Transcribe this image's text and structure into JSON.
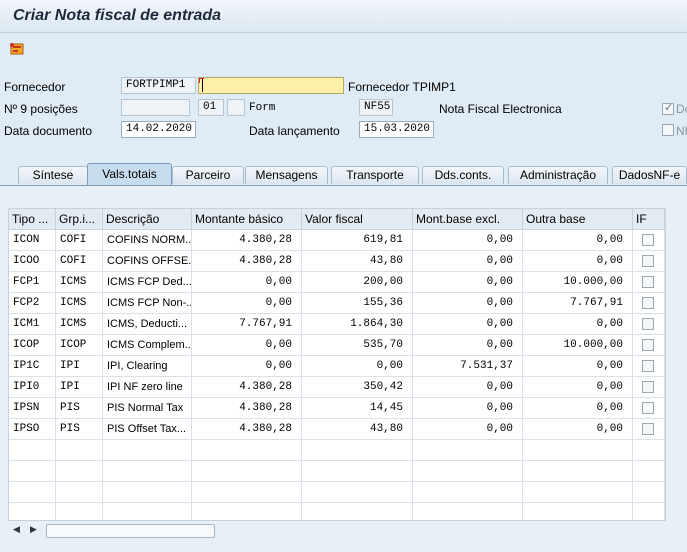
{
  "window": {
    "title": "Criar Nota fiscal de entrada"
  },
  "toolbar": {
    "icon": "header-icon"
  },
  "header": {
    "fornecedor_label": "Fornecedor",
    "fornecedor_code": "FORTPIMP1",
    "fornecedor_input": "",
    "fornecedor_name": "Fornecedor TPIMP1",
    "n9_label": "Nº 9 posições",
    "n9_value": "",
    "serie_value": "01",
    "subserie_value": "",
    "form_label": "Form",
    "form_value": "NF55",
    "form_desc": "Nota Fiscal Electronica",
    "check1_label": "Do",
    "check1_checked": true,
    "check2_label": "NF",
    "check2_checked": false,
    "data_doc_label": "Data documento",
    "data_doc_value": "14.02.2020",
    "data_lanc_label": "Data lançamento",
    "data_lanc_value": "15.03.2020"
  },
  "tabs": [
    {
      "label": "Síntese",
      "active": false
    },
    {
      "label": "Vals.totais",
      "active": true
    },
    {
      "label": "Parceiro",
      "active": false
    },
    {
      "label": "Mensagens",
      "active": false
    },
    {
      "label": "Transporte",
      "active": false
    },
    {
      "label": "Dds.conts.",
      "active": false
    },
    {
      "label": "Administração",
      "active": false
    },
    {
      "label": "DadosNF-e",
      "active": false
    }
  ],
  "table": {
    "columns": [
      "Tipo ...",
      "Grp.i...",
      "Descrição",
      "Montante básico",
      "Valor fiscal",
      "Mont.base excl.",
      "Outra base",
      "IF"
    ],
    "rows": [
      {
        "tipo": "ICON",
        "grp": "COFI",
        "desc": "COFINS NORM...",
        "montante": "4.380,28",
        "valor": "619,81",
        "excl": "0,00",
        "outra": "0,00",
        "if": false
      },
      {
        "tipo": "ICOO",
        "grp": "COFI",
        "desc": "COFINS OFFSE...",
        "montante": "4.380,28",
        "valor": "43,80",
        "excl": "0,00",
        "outra": "0,00",
        "if": false
      },
      {
        "tipo": "FCP1",
        "grp": "ICMS",
        "desc": "ICMS FCP Ded...",
        "montante": "0,00",
        "valor": "200,00",
        "excl": "0,00",
        "outra": "10.000,00",
        "if": false
      },
      {
        "tipo": "FCP2",
        "grp": "ICMS",
        "desc": "ICMS FCP Non-...",
        "montante": "0,00",
        "valor": "155,36",
        "excl": "0,00",
        "outra": "7.767,91",
        "if": false
      },
      {
        "tipo": "ICM1",
        "grp": "ICMS",
        "desc": "ICMS, Deducti...",
        "montante": "7.767,91",
        "valor": "1.864,30",
        "excl": "0,00",
        "outra": "0,00",
        "if": false
      },
      {
        "tipo": "ICOP",
        "grp": "ICOP",
        "desc": "ICMS Complem...",
        "montante": "0,00",
        "valor": "535,70",
        "excl": "0,00",
        "outra": "10.000,00",
        "if": false
      },
      {
        "tipo": "IP1C",
        "grp": "IPI",
        "desc": "IPI, Clearing",
        "montante": "0,00",
        "valor": "0,00",
        "excl": "7.531,37",
        "outra": "0,00",
        "if": false
      },
      {
        "tipo": "IPI0",
        "grp": "IPI",
        "desc": "IPI NF zero line",
        "montante": "4.380,28",
        "valor": "350,42",
        "excl": "0,00",
        "outra": "0,00",
        "if": false
      },
      {
        "tipo": "IPSN",
        "grp": "PIS",
        "desc": "PIS Normal Tax",
        "montante": "4.380,28",
        "valor": "14,45",
        "excl": "0,00",
        "outra": "0,00",
        "if": false
      },
      {
        "tipo": "IPSO",
        "grp": "PIS",
        "desc": "PIS Offset Tax...",
        "montante": "4.380,28",
        "valor": "43,80",
        "excl": "0,00",
        "outra": "0,00",
        "if": false
      }
    ],
    "empty_rows": 4
  },
  "scroll": {
    "left_icon": "arrow-left-icon",
    "right_icon": "arrow-right-icon"
  }
}
